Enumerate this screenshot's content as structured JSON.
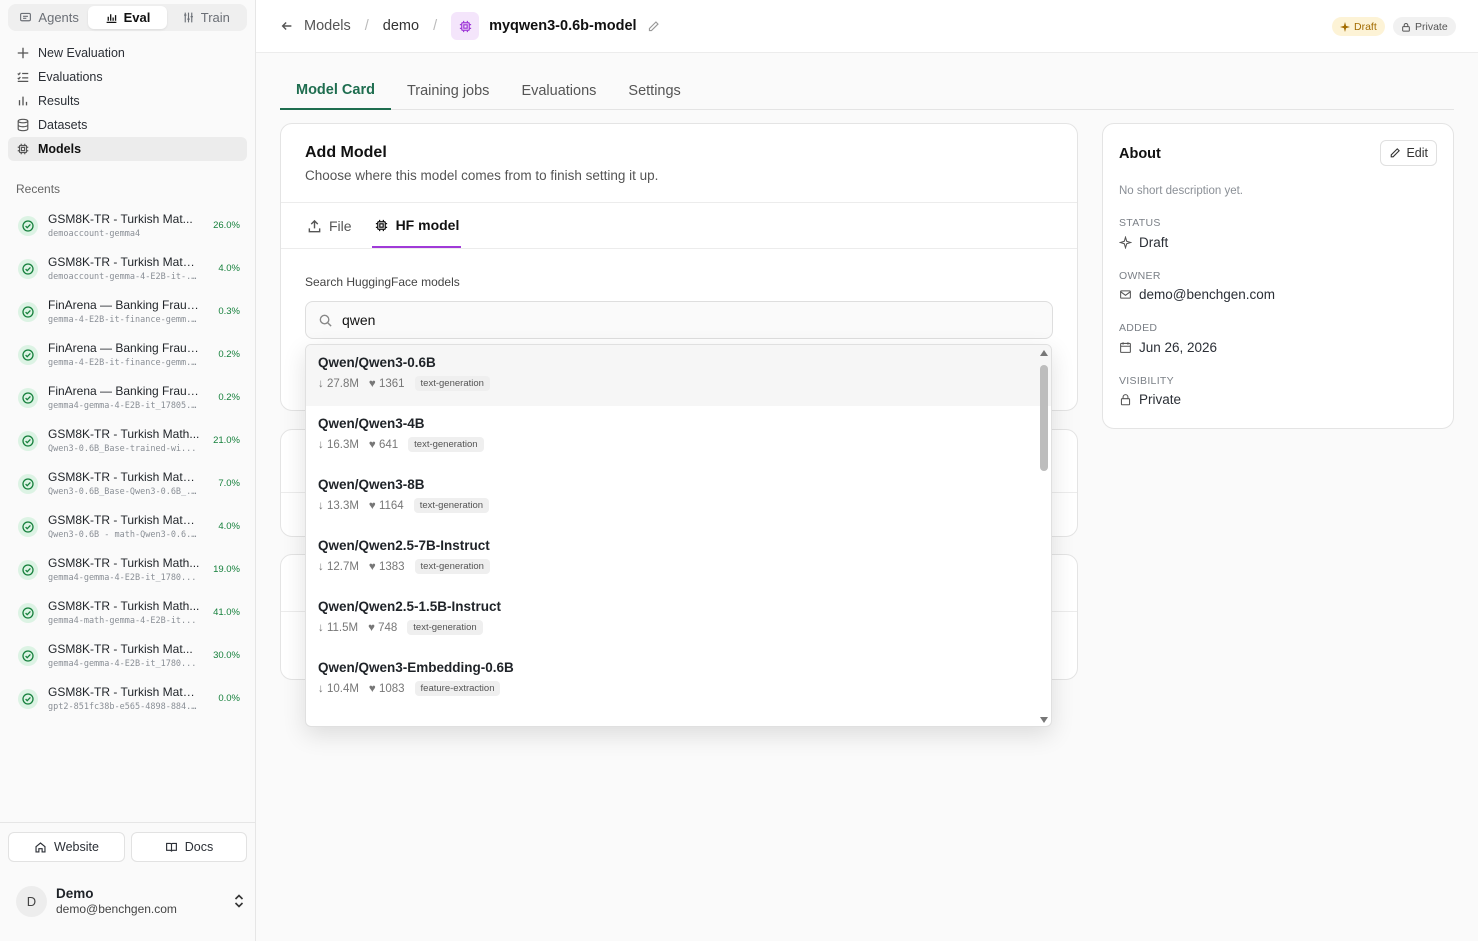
{
  "sidebar": {
    "segments": [
      {
        "label": "Agents",
        "icon": "message-icon"
      },
      {
        "label": "Eval",
        "icon": "chart-icon"
      },
      {
        "label": "Train",
        "icon": "sliders-icon"
      }
    ],
    "nav": [
      {
        "label": "New Evaluation",
        "icon": "plus-icon"
      },
      {
        "label": "Evaluations",
        "icon": "list-check-icon"
      },
      {
        "label": "Results",
        "icon": "bar-chart-icon"
      },
      {
        "label": "Datasets",
        "icon": "database-icon"
      },
      {
        "label": "Models",
        "icon": "chip-icon"
      }
    ],
    "recents_title": "Recents",
    "recents": [
      {
        "title": "GSM8K-TR - Turkish Mat...",
        "sub": "demoaccount-gemma4",
        "score": "26.0%"
      },
      {
        "title": "GSM8K-TR - Turkish Math ...",
        "sub": "demoaccount-gemma-4-E2B-it-...",
        "score": "4.0%"
      },
      {
        "title": "FinArena — Banking Fraud...",
        "sub": "gemma-4-E2B-it-finance-gemm...",
        "score": "0.3%"
      },
      {
        "title": "FinArena — Banking Fraud...",
        "sub": "gemma-4-E2B-it-finance-gemm...",
        "score": "0.2%"
      },
      {
        "title": "FinArena — Banking Fraud...",
        "sub": "gemma4-gemma-4-E2B-it_17805...",
        "score": "0.2%"
      },
      {
        "title": "GSM8K-TR - Turkish Math...",
        "sub": "Qwen3-0.6B_Base-trained-wi...",
        "score": "21.0%"
      },
      {
        "title": "GSM8K-TR - Turkish Math ...",
        "sub": "Qwen3-0.6B_Base-Qwen3-0.6B_...",
        "score": "7.0%"
      },
      {
        "title": "GSM8K-TR - Turkish Math ...",
        "sub": "Qwen3-0.6B - math-Qwen3-0.6...",
        "score": "4.0%"
      },
      {
        "title": "GSM8K-TR - Turkish Math...",
        "sub": "gemma4-gemma-4-E2B-it_1780...",
        "score": "19.0%"
      },
      {
        "title": "GSM8K-TR - Turkish Math...",
        "sub": "gemma4-math-gemma-4-E2B-it...",
        "score": "41.0%"
      },
      {
        "title": "GSM8K-TR - Turkish Mat...",
        "sub": "gemma4-gemma-4-E2B-it_1780...",
        "score": "30.0%"
      },
      {
        "title": "GSM8K-TR - Turkish Math ...",
        "sub": "gpt2-851fc38b-e565-4898-884...",
        "score": "0.0%"
      }
    ],
    "website_label": "Website",
    "docs_label": "Docs",
    "user": {
      "initial": "D",
      "name": "Demo",
      "email": "demo@benchgen.com"
    }
  },
  "header": {
    "back_label": "Models",
    "crumb2": "demo",
    "model_name": "myqwen3-0.6b-model",
    "draft_badge": "Draft",
    "private_badge": "Private"
  },
  "tabs": [
    "Model Card",
    "Training jobs",
    "Evaluations",
    "Settings"
  ],
  "add_model": {
    "title": "Add Model",
    "subtitle": "Choose where this model comes from to finish setting it up.",
    "source_tabs": [
      {
        "label": "File",
        "icon": "upload-icon"
      },
      {
        "label": "HF model",
        "icon": "chip-icon"
      }
    ],
    "search_label": "Search HuggingFace models",
    "search_value": "qwen"
  },
  "results": [
    {
      "name": "Qwen/Qwen3-0.6B",
      "downloads": "27.8M",
      "likes": "1361",
      "tag": "text-generation"
    },
    {
      "name": "Qwen/Qwen3-4B",
      "downloads": "16.3M",
      "likes": "641",
      "tag": "text-generation"
    },
    {
      "name": "Qwen/Qwen3-8B",
      "downloads": "13.3M",
      "likes": "1164",
      "tag": "text-generation"
    },
    {
      "name": "Qwen/Qwen2.5-7B-Instruct",
      "downloads": "12.7M",
      "likes": "1383",
      "tag": "text-generation"
    },
    {
      "name": "Qwen/Qwen2.5-1.5B-Instruct",
      "downloads": "11.5M",
      "likes": "748",
      "tag": "text-generation"
    },
    {
      "name": "Qwen/Qwen3-Embedding-0.6B",
      "downloads": "10.4M",
      "likes": "1083",
      "tag": "feature-extraction"
    }
  ],
  "about": {
    "title": "About",
    "edit_label": "Edit",
    "description": "No short description yet.",
    "status_label": "STATUS",
    "status_value": "Draft",
    "owner_label": "OWNER",
    "owner_value": "demo@benchgen.com",
    "added_label": "ADDED",
    "added_value": "Jun 26, 2026",
    "visibility_label": "VISIBILITY",
    "visibility_value": "Private"
  },
  "colors": {
    "accent_green": "#1e6d4f",
    "accent_purple": "#a03ad8",
    "success": "#16803c"
  }
}
